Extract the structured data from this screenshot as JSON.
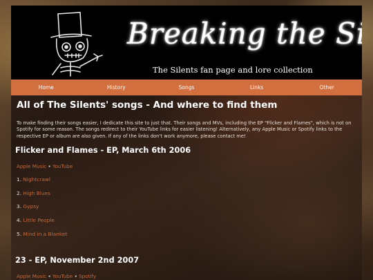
{
  "banner": {
    "title": "Breaking the Silents",
    "subtitle": "The Silents fan page and lore collection"
  },
  "nav": [
    "Home",
    "History",
    "Songs",
    "Links",
    "Other"
  ],
  "page_title": "All of The Silents' songs - And where to find them",
  "intro": "To make finding their songs easier, I dedicate this site to just that. Their songs and MVs, including the EP \"Flicker and Flames\", which is not on Spotify for some reason. The songs redirect to their YouTube links for easier listening! Alternatively, any Apple Music or Spotify links to the respective EP or album are also given. If any of the links don't work anymore, please contact me!",
  "releases": [
    {
      "title": "Flicker and Flames - EP, March 6th 2006",
      "links": [
        "Apple Music",
        "YouTube"
      ],
      "tracks": [
        "Nightcrawl",
        "High Blues",
        "Gypsy",
        "Little People",
        "Mind in a Blanket"
      ]
    },
    {
      "title": "23 - EP, November 2nd 2007",
      "links": [
        "Apple Music",
        "YouTube",
        "Spotify"
      ],
      "tracks": []
    }
  ],
  "colors": {
    "nav": "#d26f3f",
    "link": "#c26a3d",
    "banner": "#000000"
  }
}
